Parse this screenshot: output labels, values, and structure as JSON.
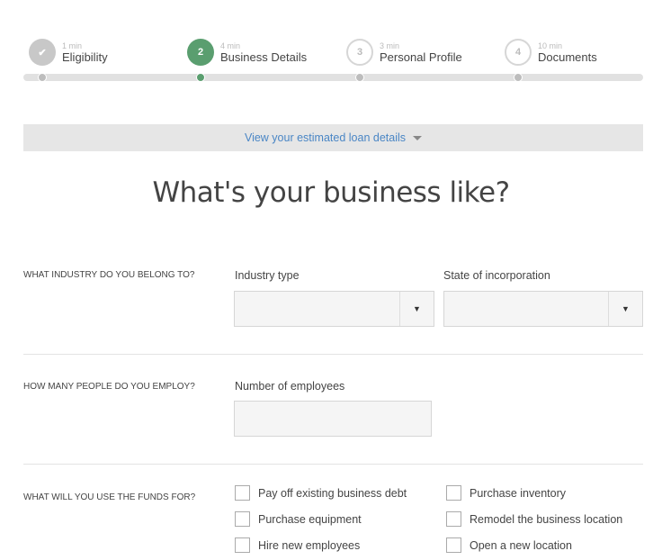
{
  "steps": [
    {
      "time": "1 min",
      "label": "Eligibility",
      "badge": "✔",
      "state": "done"
    },
    {
      "time": "4 min",
      "label": "Business Details",
      "badge": "2",
      "state": "active"
    },
    {
      "time": "3 min",
      "label": "Personal Profile",
      "badge": "3",
      "state": "todo"
    },
    {
      "time": "10 min",
      "label": "Documents",
      "badge": "4",
      "state": "todo"
    }
  ],
  "colors": {
    "accent": "#5a9e6f",
    "link": "#4a86c5"
  },
  "banner": {
    "label": "View your estimated loan details"
  },
  "heading": "What's your business like?",
  "sections": {
    "industry": {
      "question": "What industry do you belong to?",
      "industry_label": "Industry type",
      "industry_value": "",
      "state_label": "State of incorporation",
      "state_value": "",
      "arrow": "▼"
    },
    "employees": {
      "question": "How many people do you employ?",
      "label": "Number of employees",
      "value": ""
    },
    "funds": {
      "question": "What will you use the funds for?",
      "options": [
        "Pay off existing business debt",
        "Purchase inventory",
        "Purchase equipment",
        "Remodel the business location",
        "Hire new employees",
        "Open a new location"
      ]
    }
  }
}
